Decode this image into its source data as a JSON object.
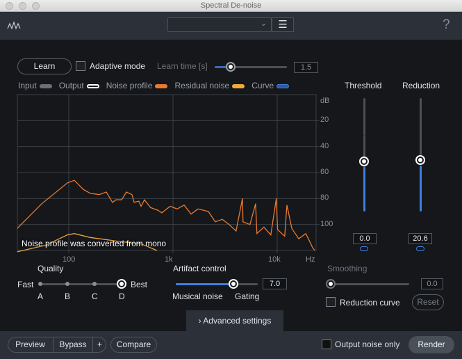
{
  "window": {
    "title": "Spectral De-noise"
  },
  "header": {
    "help_label": "?",
    "preset_value": ""
  },
  "learn": {
    "button": "Learn",
    "adaptive_label": "Adaptive mode",
    "adaptive_checked": false,
    "learn_time_label": "Learn time [s]",
    "learn_time_value": "1.5"
  },
  "legend": [
    {
      "label": "Input",
      "color": "#6b7078"
    },
    {
      "label": "Output",
      "color": "#ffffff"
    },
    {
      "label": "Noise profile",
      "color": "#e87a30"
    },
    {
      "label": "Residual noise",
      "color": "#f2a93b"
    },
    {
      "label": "Curve",
      "color": "#3f7fe0"
    }
  ],
  "graph": {
    "message": "Noise profile was converted from mono",
    "db_unit": "dB",
    "hz_unit": "Hz",
    "db_ticks": [
      "20",
      "40",
      "60",
      "80",
      "100"
    ],
    "hz_ticks": [
      "100",
      "1k",
      "10k"
    ]
  },
  "chart_data": {
    "type": "line",
    "x_scale": "log",
    "xlim": [
      32,
      22000
    ],
    "ylim": [
      0,
      120
    ],
    "y_inverted": true,
    "grid": true,
    "series": [
      {
        "name": "Noise profile",
        "color": "#e87a30",
        "x": [
          32,
          55,
          97,
          113,
          138,
          161,
          196,
          229,
          263,
          284,
          321,
          357,
          404,
          424,
          470,
          494,
          532,
          610,
          714,
          782,
          870,
          940,
          1096,
          1278,
          1490,
          1738,
          2186,
          2547,
          2968,
          3458,
          4030,
          4640,
          4700,
          5480,
          6200,
          6390,
          7450,
          8680,
          9800,
          10100,
          11800,
          12400,
          13800,
          16100,
          18800,
          20200,
          21900,
          23000
        ],
        "y": [
          103,
          84,
          68,
          66,
          73,
          76,
          77,
          75,
          83,
          81,
          81,
          75,
          77,
          83,
          82,
          86,
          81,
          87,
          89,
          91,
          88,
          86,
          88,
          85,
          92,
          88,
          90,
          98,
          96,
          100,
          105,
          80,
          98,
          100,
          84,
          107,
          102,
          108,
          80,
          104,
          109,
          85,
          103,
          111,
          107,
          112,
          118,
          120
        ]
      },
      {
        "name": "Residual noise",
        "color": "#f2a93b",
        "x": [
          32,
          60,
          97,
          113,
          160,
          300,
          500,
          700
        ],
        "y": [
          121,
          116,
          108,
          107,
          110,
          113,
          115,
          120
        ]
      }
    ]
  },
  "threshold": {
    "label": "Threshold",
    "value": "0.0",
    "level": 0.42
  },
  "reduction": {
    "label": "Reduction",
    "value": "20.6",
    "level": 0.43
  },
  "quality": {
    "label": "Quality",
    "fast": "Fast",
    "best": "Best",
    "options": [
      "A",
      "B",
      "C",
      "D"
    ],
    "selected": "D"
  },
  "artifact": {
    "label": "Artifact control",
    "value": "7.0",
    "left": "Musical noise",
    "right": "Gating",
    "level": 0.7
  },
  "smoothing": {
    "label": "Smoothing",
    "value": "0.0",
    "level": 0
  },
  "reduction_curve": {
    "label": "Reduction curve",
    "checked": false,
    "reset": "Reset"
  },
  "advanced": {
    "label": "Advanced settings"
  },
  "footer": {
    "preview": "Preview",
    "bypass": "Bypass",
    "plus": "+",
    "compare": "Compare",
    "output_noise_only": "Output noise only",
    "render": "Render"
  }
}
